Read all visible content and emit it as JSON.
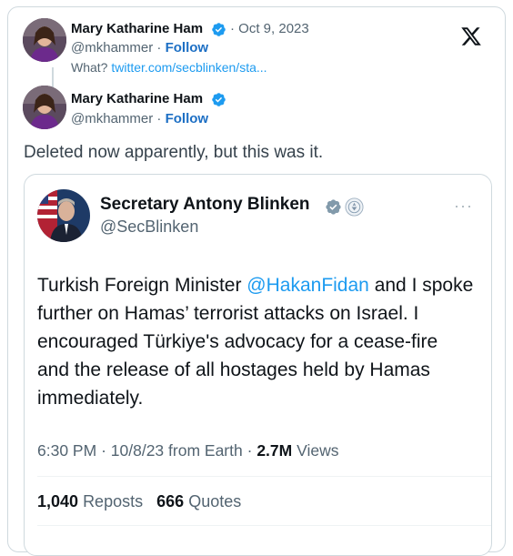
{
  "tweet": {
    "author_name": "Mary Katharine Ham",
    "date": "Oct 9, 2023",
    "handle": "@mkhammer",
    "separator": "·",
    "follow_label": "Follow",
    "reply_prefix": "What?",
    "reply_link": "twitter.com/secblinken/sta...",
    "platform_icon": "x-logo-icon"
  },
  "reply": {
    "author_name": "Mary Katharine Ham",
    "handle": "@mkhammer",
    "follow_label": "Follow",
    "text": "Deleted now apparently, but this was it."
  },
  "quoted": {
    "author_name": "Secretary Antony Blinken",
    "handle": "@SecBlinken",
    "more_label": "···",
    "text_before": "Turkish Foreign Minister ",
    "mention": "@HakanFidan",
    "text_after": " and I spoke further on Hamas’ terrorist attacks on Israel. I encouraged Türkiye's advocacy for a cease-fire and the release of all hostages held by Hamas immediately.",
    "time": "6:30 PM",
    "date": "10/8/23",
    "source": "from Earth",
    "views_count": "2.7M",
    "views_label": "Views",
    "reposts_count": "1,040",
    "reposts_label": "Reposts",
    "quotes_count": "666",
    "quotes_label": "Quotes"
  },
  "colors": {
    "accent": "#1d9bf0",
    "verified": "#1d9bf0",
    "gov_badge": "#829aab",
    "text_primary": "#0f1419",
    "text_secondary": "#536471",
    "border": "#cfd9de"
  }
}
